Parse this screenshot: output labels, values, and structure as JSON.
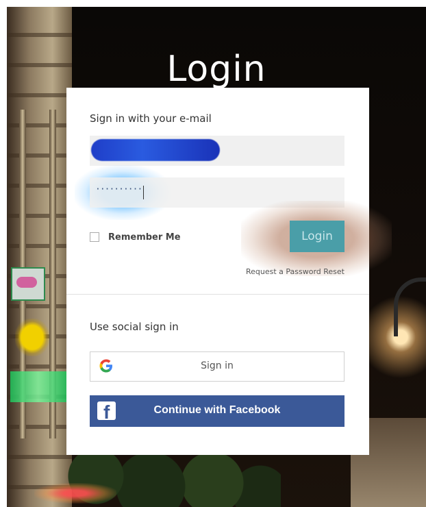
{
  "page": {
    "title": "Login"
  },
  "email_section": {
    "heading": "Sign in with your e-mail",
    "email_value": "",
    "password_mask": "··········"
  },
  "remember_me": {
    "label": "Remember Me",
    "checked": false
  },
  "login_button": {
    "label": "Login"
  },
  "reset_link": {
    "label": "Request a Password Reset"
  },
  "social_section": {
    "heading": "Use social sign in",
    "google": {
      "label": "Sign in",
      "icon": "google-g-icon"
    },
    "facebook": {
      "label": "Continue with Facebook",
      "icon": "facebook-f-icon"
    }
  },
  "colors": {
    "login_button": "#4a9ea8",
    "facebook": "#3b5998",
    "field_bg": "#f0f0f0"
  }
}
